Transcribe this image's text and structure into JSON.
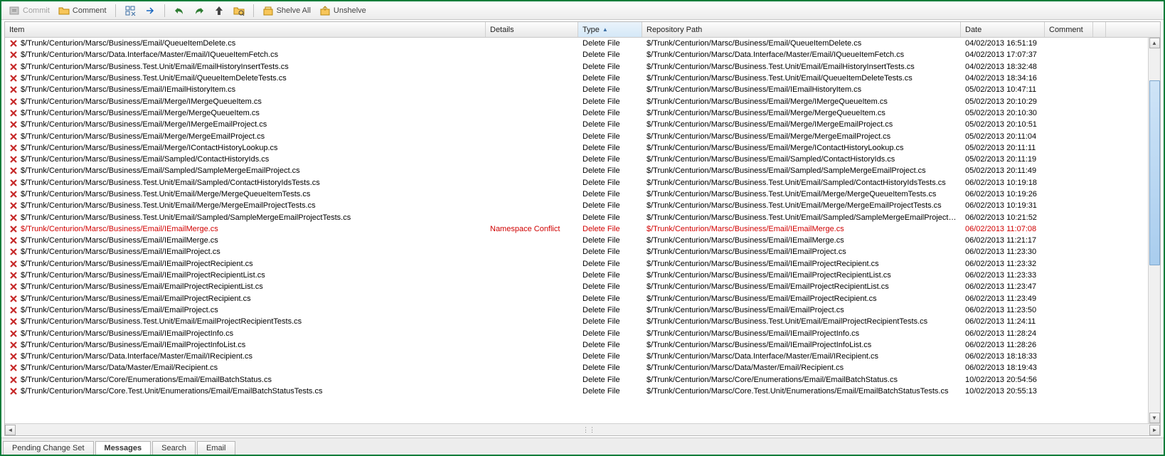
{
  "toolbar": {
    "commit": "Commit",
    "comment": "Comment",
    "shelve_all": "Shelve All",
    "unshelve": "Unshelve"
  },
  "columns": {
    "item": "Item",
    "details": "Details",
    "type": "Type",
    "repo": "Repository Path",
    "date": "Date",
    "comment": "Comment"
  },
  "rows": [
    {
      "item": "$/Trunk/Centurion/Marsc/Business/Email/QueueItemDelete.cs",
      "details": "",
      "type": "Delete File",
      "repo": "$/Trunk/Centurion/Marsc/Business/Email/QueueItemDelete.cs",
      "date": "04/02/2013 16:51:19",
      "conflict": false
    },
    {
      "item": "$/Trunk/Centurion/Marsc/Data.Interface/Master/Email/IQueueItemFetch.cs",
      "details": "",
      "type": "Delete File",
      "repo": "$/Trunk/Centurion/Marsc/Data.Interface/Master/Email/IQueueItemFetch.cs",
      "date": "04/02/2013 17:07:37",
      "conflict": false
    },
    {
      "item": "$/Trunk/Centurion/Marsc/Business.Test.Unit/Email/EmailHistoryInsertTests.cs",
      "details": "",
      "type": "Delete File",
      "repo": "$/Trunk/Centurion/Marsc/Business.Test.Unit/Email/EmailHistoryInsertTests.cs",
      "date": "04/02/2013 18:32:48",
      "conflict": false
    },
    {
      "item": "$/Trunk/Centurion/Marsc/Business.Test.Unit/Email/QueueItemDeleteTests.cs",
      "details": "",
      "type": "Delete File",
      "repo": "$/Trunk/Centurion/Marsc/Business.Test.Unit/Email/QueueItemDeleteTests.cs",
      "date": "04/02/2013 18:34:16",
      "conflict": false
    },
    {
      "item": "$/Trunk/Centurion/Marsc/Business/Email/IEmailHistoryItem.cs",
      "details": "",
      "type": "Delete File",
      "repo": "$/Trunk/Centurion/Marsc/Business/Email/IEmailHistoryItem.cs",
      "date": "05/02/2013 10:47:11",
      "conflict": false
    },
    {
      "item": "$/Trunk/Centurion/Marsc/Business/Email/Merge/IMergeQueueItem.cs",
      "details": "",
      "type": "Delete File",
      "repo": "$/Trunk/Centurion/Marsc/Business/Email/Merge/IMergeQueueItem.cs",
      "date": "05/02/2013 20:10:29",
      "conflict": false
    },
    {
      "item": "$/Trunk/Centurion/Marsc/Business/Email/Merge/MergeQueueItem.cs",
      "details": "",
      "type": "Delete File",
      "repo": "$/Trunk/Centurion/Marsc/Business/Email/Merge/MergeQueueItem.cs",
      "date": "05/02/2013 20:10:30",
      "conflict": false
    },
    {
      "item": "$/Trunk/Centurion/Marsc/Business/Email/Merge/IMergeEmailProject.cs",
      "details": "",
      "type": "Delete File",
      "repo": "$/Trunk/Centurion/Marsc/Business/Email/Merge/IMergeEmailProject.cs",
      "date": "05/02/2013 20:10:51",
      "conflict": false
    },
    {
      "item": "$/Trunk/Centurion/Marsc/Business/Email/Merge/MergeEmailProject.cs",
      "details": "",
      "type": "Delete File",
      "repo": "$/Trunk/Centurion/Marsc/Business/Email/Merge/MergeEmailProject.cs",
      "date": "05/02/2013 20:11:04",
      "conflict": false
    },
    {
      "item": "$/Trunk/Centurion/Marsc/Business/Email/Merge/IContactHistoryLookup.cs",
      "details": "",
      "type": "Delete File",
      "repo": "$/Trunk/Centurion/Marsc/Business/Email/Merge/IContactHistoryLookup.cs",
      "date": "05/02/2013 20:11:11",
      "conflict": false
    },
    {
      "item": "$/Trunk/Centurion/Marsc/Business/Email/Sampled/ContactHistoryIds.cs",
      "details": "",
      "type": "Delete File",
      "repo": "$/Trunk/Centurion/Marsc/Business/Email/Sampled/ContactHistoryIds.cs",
      "date": "05/02/2013 20:11:19",
      "conflict": false
    },
    {
      "item": "$/Trunk/Centurion/Marsc/Business/Email/Sampled/SampleMergeEmailProject.cs",
      "details": "",
      "type": "Delete File",
      "repo": "$/Trunk/Centurion/Marsc/Business/Email/Sampled/SampleMergeEmailProject.cs",
      "date": "05/02/2013 20:11:49",
      "conflict": false
    },
    {
      "item": "$/Trunk/Centurion/Marsc/Business.Test.Unit/Email/Sampled/ContactHistoryIdsTests.cs",
      "details": "",
      "type": "Delete File",
      "repo": "$/Trunk/Centurion/Marsc/Business.Test.Unit/Email/Sampled/ContactHistoryIdsTests.cs",
      "date": "06/02/2013 10:19:18",
      "conflict": false
    },
    {
      "item": "$/Trunk/Centurion/Marsc/Business.Test.Unit/Email/Merge/MergeQueueItemTests.cs",
      "details": "",
      "type": "Delete File",
      "repo": "$/Trunk/Centurion/Marsc/Business.Test.Unit/Email/Merge/MergeQueueItemTests.cs",
      "date": "06/02/2013 10:19:26",
      "conflict": false
    },
    {
      "item": "$/Trunk/Centurion/Marsc/Business.Test.Unit/Email/Merge/MergeEmailProjectTests.cs",
      "details": "",
      "type": "Delete File",
      "repo": "$/Trunk/Centurion/Marsc/Business.Test.Unit/Email/Merge/MergeEmailProjectTests.cs",
      "date": "06/02/2013 10:19:31",
      "conflict": false
    },
    {
      "item": "$/Trunk/Centurion/Marsc/Business.Test.Unit/Email/Sampled/SampleMergeEmailProjectTests.cs",
      "details": "",
      "type": "Delete File",
      "repo": "$/Trunk/Centurion/Marsc/Business.Test.Unit/Email/Sampled/SampleMergeEmailProjectTest...",
      "date": "06/02/2013 10:21:52",
      "conflict": false
    },
    {
      "item": "$/Trunk/Centurion/Marsc/Business/Email/IEmailMerge.cs",
      "details": "Namespace Conflict",
      "type": "Delete File",
      "repo": "$/Trunk/Centurion/Marsc/Business/Email/IEmailMerge.cs",
      "date": "06/02/2013 11:07:08",
      "conflict": true
    },
    {
      "item": "$/Trunk/Centurion/Marsc/Business/Email/IEmailMerge.cs",
      "details": "",
      "type": "Delete File",
      "repo": "$/Trunk/Centurion/Marsc/Business/Email/IEmailMerge.cs",
      "date": "06/02/2013 11:21:17",
      "conflict": false
    },
    {
      "item": "$/Trunk/Centurion/Marsc/Business/Email/IEmailProject.cs",
      "details": "",
      "type": "Delete File",
      "repo": "$/Trunk/Centurion/Marsc/Business/Email/IEmailProject.cs",
      "date": "06/02/2013 11:23:30",
      "conflict": false
    },
    {
      "item": "$/Trunk/Centurion/Marsc/Business/Email/IEmailProjectRecipient.cs",
      "details": "",
      "type": "Delete File",
      "repo": "$/Trunk/Centurion/Marsc/Business/Email/IEmailProjectRecipient.cs",
      "date": "06/02/2013 11:23:32",
      "conflict": false
    },
    {
      "item": "$/Trunk/Centurion/Marsc/Business/Email/IEmailProjectRecipientList.cs",
      "details": "",
      "type": "Delete File",
      "repo": "$/Trunk/Centurion/Marsc/Business/Email/IEmailProjectRecipientList.cs",
      "date": "06/02/2013 11:23:33",
      "conflict": false
    },
    {
      "item": "$/Trunk/Centurion/Marsc/Business/Email/EmailProjectRecipientList.cs",
      "details": "",
      "type": "Delete File",
      "repo": "$/Trunk/Centurion/Marsc/Business/Email/EmailProjectRecipientList.cs",
      "date": "06/02/2013 11:23:47",
      "conflict": false
    },
    {
      "item": "$/Trunk/Centurion/Marsc/Business/Email/EmailProjectRecipient.cs",
      "details": "",
      "type": "Delete File",
      "repo": "$/Trunk/Centurion/Marsc/Business/Email/EmailProjectRecipient.cs",
      "date": "06/02/2013 11:23:49",
      "conflict": false
    },
    {
      "item": "$/Trunk/Centurion/Marsc/Business/Email/EmailProject.cs",
      "details": "",
      "type": "Delete File",
      "repo": "$/Trunk/Centurion/Marsc/Business/Email/EmailProject.cs",
      "date": "06/02/2013 11:23:50",
      "conflict": false
    },
    {
      "item": "$/Trunk/Centurion/Marsc/Business.Test.Unit/Email/EmailProjectRecipientTests.cs",
      "details": "",
      "type": "Delete File",
      "repo": "$/Trunk/Centurion/Marsc/Business.Test.Unit/Email/EmailProjectRecipientTests.cs",
      "date": "06/02/2013 11:24:11",
      "conflict": false
    },
    {
      "item": "$/Trunk/Centurion/Marsc/Business/Email/IEmailProjectInfo.cs",
      "details": "",
      "type": "Delete File",
      "repo": "$/Trunk/Centurion/Marsc/Business/Email/IEmailProjectInfo.cs",
      "date": "06/02/2013 11:28:24",
      "conflict": false
    },
    {
      "item": "$/Trunk/Centurion/Marsc/Business/Email/IEmailProjectInfoList.cs",
      "details": "",
      "type": "Delete File",
      "repo": "$/Trunk/Centurion/Marsc/Business/Email/IEmailProjectInfoList.cs",
      "date": "06/02/2013 11:28:26",
      "conflict": false
    },
    {
      "item": "$/Trunk/Centurion/Marsc/Data.Interface/Master/Email/IRecipient.cs",
      "details": "",
      "type": "Delete File",
      "repo": "$/Trunk/Centurion/Marsc/Data.Interface/Master/Email/IRecipient.cs",
      "date": "06/02/2013 18:18:33",
      "conflict": false
    },
    {
      "item": "$/Trunk/Centurion/Marsc/Data/Master/Email/Recipient.cs",
      "details": "",
      "type": "Delete File",
      "repo": "$/Trunk/Centurion/Marsc/Data/Master/Email/Recipient.cs",
      "date": "06/02/2013 18:19:43",
      "conflict": false
    },
    {
      "item": "$/Trunk/Centurion/Marsc/Core/Enumerations/Email/EmailBatchStatus.cs",
      "details": "",
      "type": "Delete File",
      "repo": "$/Trunk/Centurion/Marsc/Core/Enumerations/Email/EmailBatchStatus.cs",
      "date": "10/02/2013 20:54:56",
      "conflict": false
    },
    {
      "item": "$/Trunk/Centurion/Marsc/Core.Test.Unit/Enumerations/Email/EmailBatchStatusTests.cs",
      "details": "",
      "type": "Delete File",
      "repo": "$/Trunk/Centurion/Marsc/Core.Test.Unit/Enumerations/Email/EmailBatchStatusTests.cs",
      "date": "10/02/2013 20:55:13",
      "conflict": false
    }
  ],
  "tabs": {
    "pending": "Pending Change Set",
    "messages": "Messages",
    "search": "Search",
    "email": "Email"
  }
}
